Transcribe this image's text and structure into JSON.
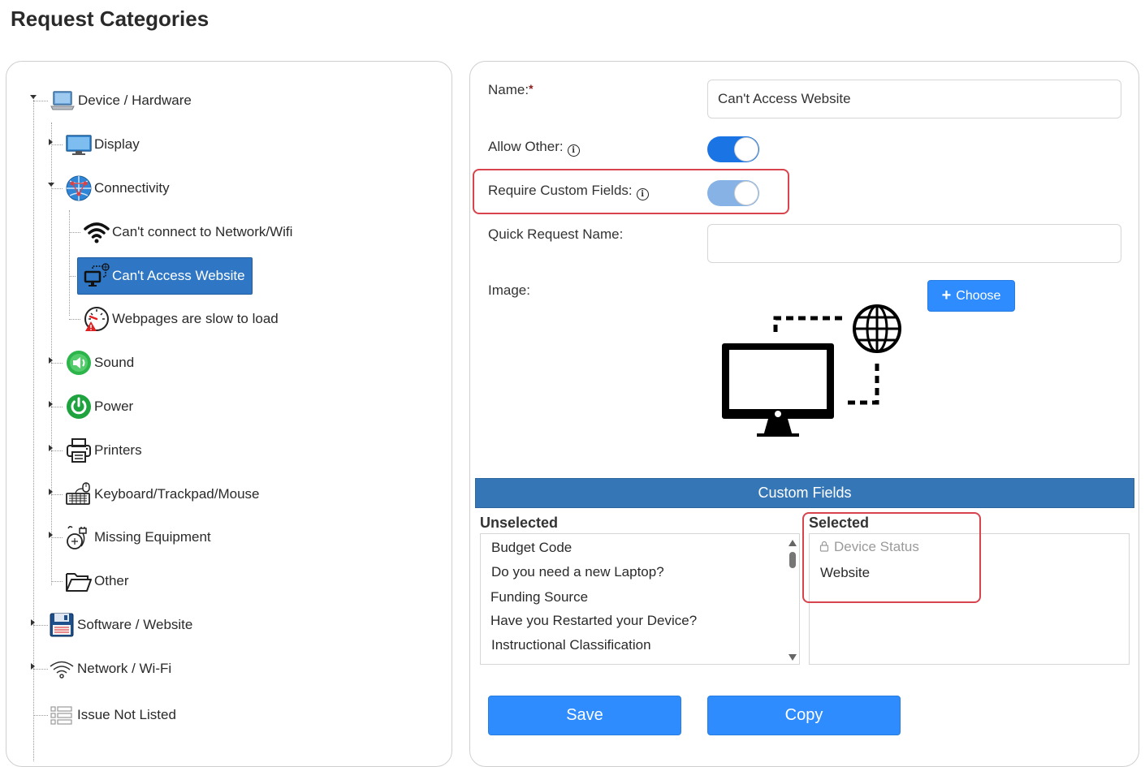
{
  "page": {
    "title": "Request Categories"
  },
  "tree": {
    "nodes": [
      {
        "label": "Device / Hardware",
        "icon": "laptop-icon"
      },
      {
        "label": "Display",
        "icon": "monitor-icon"
      },
      {
        "label": "Connectivity",
        "icon": "network-globe-icon"
      },
      {
        "label": "Can't connect to Network/Wifi",
        "icon": "wifi-icon"
      },
      {
        "label": "Can't Access Website",
        "icon": "computer-globe-icon",
        "selected": true
      },
      {
        "label": "Webpages are slow to load",
        "icon": "speedometer-warning-icon"
      },
      {
        "label": "Sound",
        "icon": "speaker-icon"
      },
      {
        "label": "Power",
        "icon": "power-icon"
      },
      {
        "label": "Printers",
        "icon": "printer-icon"
      },
      {
        "label": "Keyboard/Trackpad/Mouse",
        "icon": "keyboard-mouse-icon"
      },
      {
        "label": "Missing Equipment",
        "icon": "missing-equipment-icon"
      },
      {
        "label": "Other",
        "icon": "folder-open-icon"
      },
      {
        "label": "Software / Website",
        "icon": "floppy-disk-icon"
      },
      {
        "label": "Network / Wi-Fi",
        "icon": "wifi-outline-icon"
      },
      {
        "label": "Issue Not Listed",
        "icon": "list-icon"
      }
    ]
  },
  "form": {
    "name_label": "Name:",
    "name_required_mark": "*",
    "name_value": "Can't Access Website",
    "allow_other_label": "Allow Other:",
    "allow_other_on": true,
    "require_custom_label": "Require Custom Fields:",
    "require_custom_on": true,
    "info_glyph": "i",
    "quick_request_label": "Quick Request Name:",
    "quick_request_value": "",
    "image_label": "Image:",
    "choose_plus": "+",
    "choose_label": "Choose",
    "image_icon": "computer-globe-icon"
  },
  "custom_fields": {
    "header": "Custom Fields",
    "unselected_title": "Unselected",
    "selected_title": "Selected",
    "unselected": [
      "Budget Code",
      "Do you need a new Laptop?",
      "Funding Source",
      "Have you Restarted your Device?",
      "Instructional Classification"
    ],
    "selected": [
      {
        "label": "Device Status",
        "locked": true
      },
      {
        "label": "Website",
        "locked": false
      }
    ]
  },
  "actions": {
    "save_label": "Save",
    "copy_label": "Copy"
  },
  "colors": {
    "primary": "#2f8cff",
    "selected_node": "#2f77c4",
    "panel_header": "#3577b6",
    "highlight": "#d9434d",
    "toggle_on": "#1b74e4",
    "toggle_disabled": "#86b2e6"
  }
}
